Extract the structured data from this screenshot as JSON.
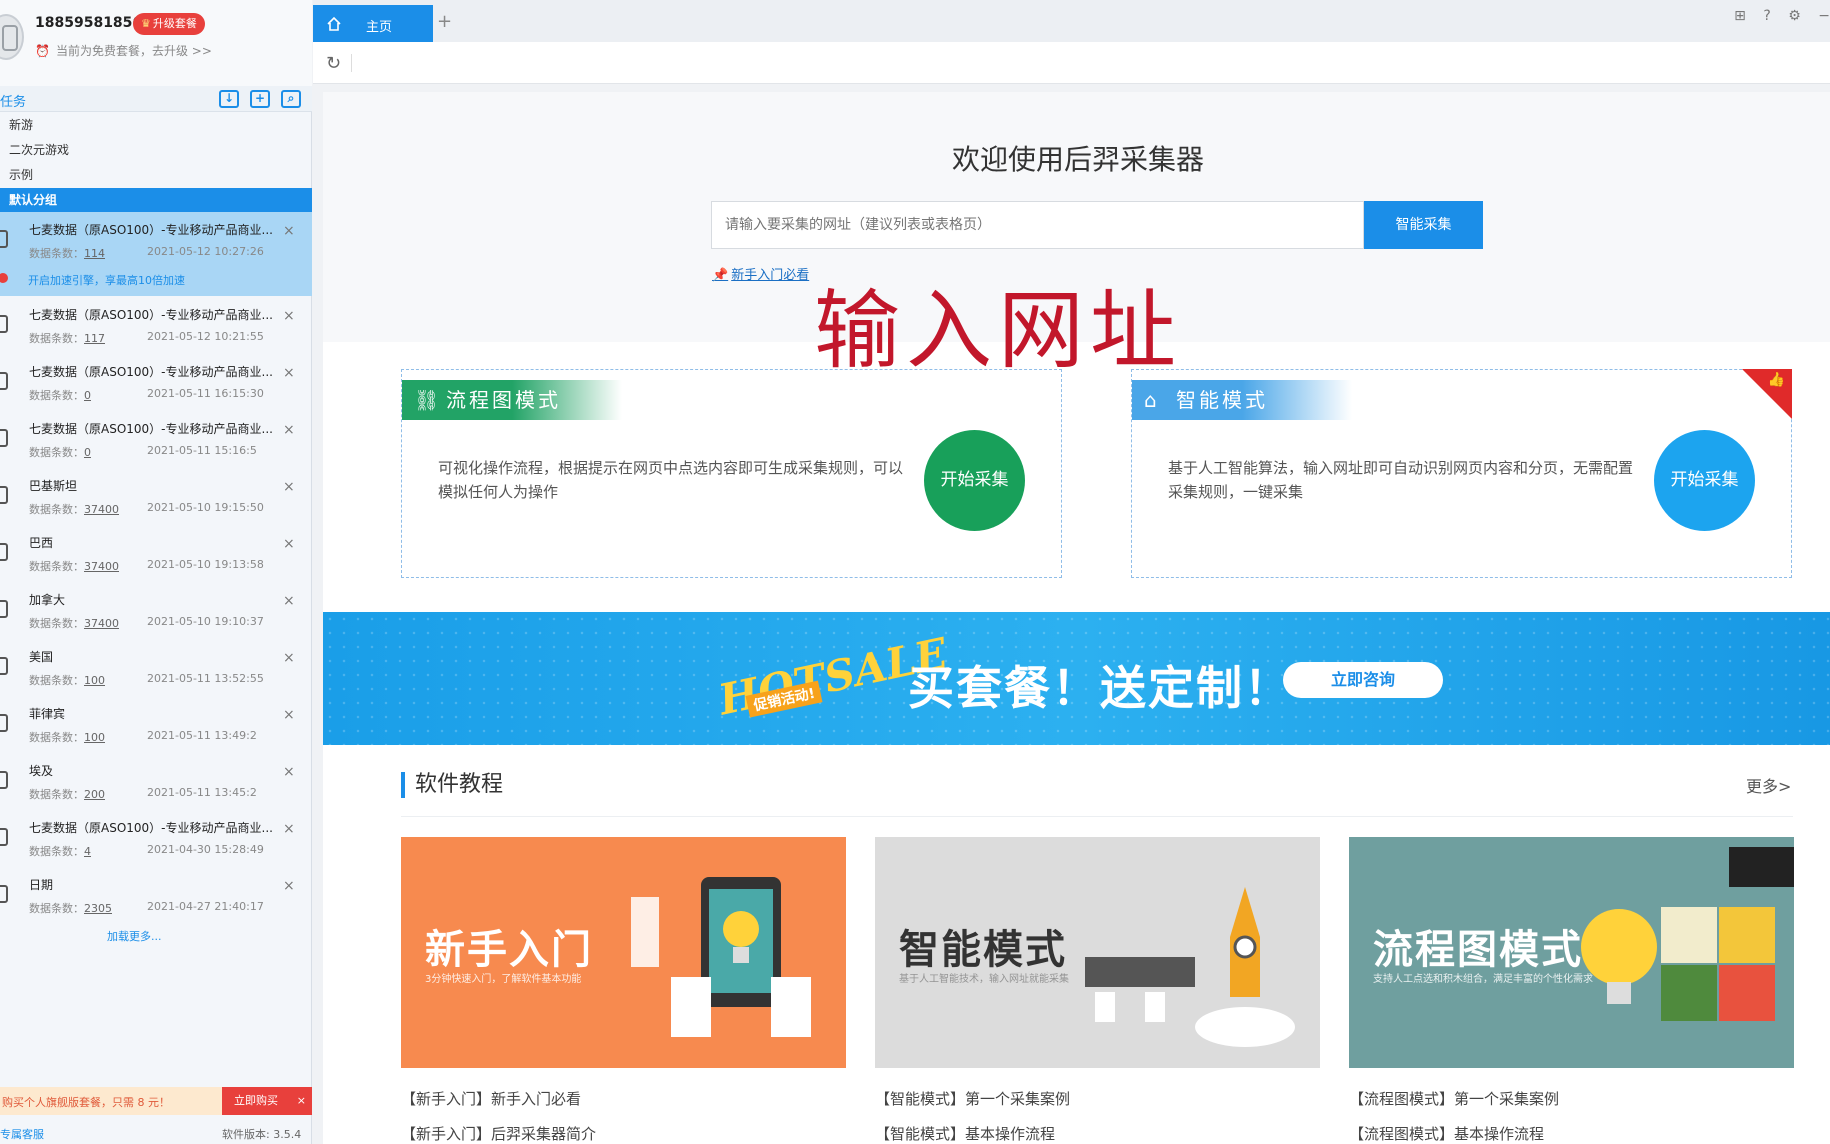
{
  "user": {
    "phone": "18859581856",
    "upgrade_label": "升级套餐",
    "plan_text": "当前为免费套餐，去升级 >>"
  },
  "sidebar": {
    "task_title": "任务",
    "groups": [
      "新游",
      "二次元游戏",
      "示例",
      "默认分组"
    ],
    "count_label": "数据条数：",
    "accel_text": "开启加速引擎，享最高10倍加速",
    "tasks": [
      {
        "name": "七麦数据（原ASO100）-专业移动产品商业...",
        "count": "114",
        "date": "2021-05-12 10:27:26"
      },
      {
        "name": "七麦数据（原ASO100）-专业移动产品商业...",
        "count": "117",
        "date": "2021-05-12 10:21:55"
      },
      {
        "name": "七麦数据（原ASO100）-专业移动产品商业...",
        "count": "0",
        "date": "2021-05-11 16:15:30"
      },
      {
        "name": "七麦数据（原ASO100）-专业移动产品商业...",
        "count": "0",
        "date": "2021-05-11 15:16:5"
      },
      {
        "name": "巴基斯坦",
        "count": "37400",
        "date": "2021-05-10 19:15:50"
      },
      {
        "name": "巴西",
        "count": "37400",
        "date": "2021-05-10 19:13:58"
      },
      {
        "name": "加拿大",
        "count": "37400",
        "date": "2021-05-10 19:10:37"
      },
      {
        "name": "美国",
        "count": "100",
        "date": "2021-05-11 13:52:55"
      },
      {
        "name": "菲律宾",
        "count": "100",
        "date": "2021-05-11 13:49:2"
      },
      {
        "name": "埃及",
        "count": "200",
        "date": "2021-05-11 13:45:2"
      },
      {
        "name": "七麦数据（原ASO100）-专业移动产品商业...",
        "count": "4",
        "date": "2021-04-30 15:28:49"
      },
      {
        "name": "日期",
        "count": "2305",
        "date": "2021-04-27 21:40:17"
      }
    ],
    "load_more": "加载更多...",
    "promo_text": "购买个人旗舰版套餐，只需 8 元！",
    "promo_button": "立即购买",
    "service_link": "专属客服",
    "version": "软件版本: 3.5.4"
  },
  "tabs": {
    "home_label": "主页",
    "add_symbol": "+"
  },
  "window_icons": [
    "gift-icon",
    "help-icon",
    "settings-icon",
    "minimize-icon"
  ],
  "main": {
    "welcome_title": "欢迎使用后羿采集器",
    "url_placeholder": "请输入要采集的网址（建议列表或表格页）",
    "smart_button": "智能采集",
    "newbie_link": "新手入门必看",
    "overlay_caption": "输入网址",
    "modes": [
      {
        "title": "流程图模式",
        "desc": "可视化操作流程，根据提示在网页中点选内容即可生成采集规则，可以模拟任何人为操作",
        "button": "开始采集",
        "color": "#18a05a"
      },
      {
        "title": "智能模式",
        "desc": "基于人工智能算法，输入网址即可自动识别网页内容和分页，无需配置采集规则，一键采集",
        "button": "开始采集",
        "color": "#1ca4ef"
      }
    ],
    "banner": {
      "hot": "HOTSALE",
      "tag": "促销活动!",
      "slogan": "买套餐！送定制！",
      "button": "立即咨询"
    },
    "tutorial_section": {
      "title": "软件教程",
      "more": "更多>",
      "cards": [
        {
          "title": "新手入门",
          "subtitle": "3分钟快速入门，了解软件基本功能"
        },
        {
          "title": "智能模式",
          "subtitle": "基于人工智能技术，输入网址就能采集"
        },
        {
          "title": "流程图模式",
          "subtitle": "支持人工点选和积木组合，满足丰富的个性化需求"
        }
      ],
      "links": [
        [
          "【新手入门】新手入门必看",
          "【新手入门】后羿采集器简介"
        ],
        [
          "【智能模式】第一个采集案例",
          "【智能模式】基本操作流程"
        ],
        [
          "【流程图模式】第一个采集案例",
          "【流程图模式】基本操作流程"
        ]
      ]
    }
  }
}
